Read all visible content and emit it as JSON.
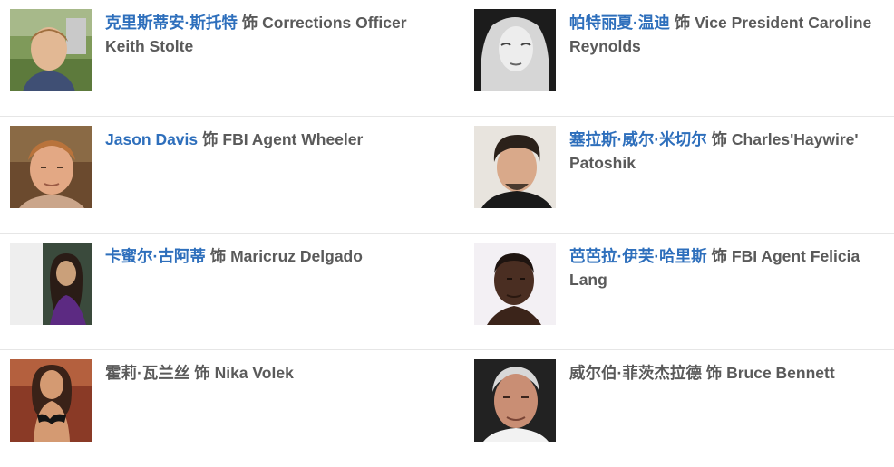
{
  "cast": [
    {
      "actor": "克里斯蒂安·斯托特",
      "actor_linked": true,
      "role_prefix": "饰",
      "role": "Corrections Officer Keith Stolte",
      "photo": "portrait-young-man-outdoors"
    },
    {
      "actor": "帕特丽夏·温迪",
      "actor_linked": true,
      "role_prefix": "饰",
      "role": "Vice President Caroline Reynolds",
      "photo": "portrait-blonde-woman-bw"
    },
    {
      "actor": "Jason Davis",
      "actor_linked": true,
      "role_prefix": "饰",
      "role": "FBI Agent Wheeler",
      "photo": "portrait-ginger-man"
    },
    {
      "actor": "塞拉斯·威尔·米切尔",
      "actor_linked": true,
      "role_prefix": "饰",
      "role": "Charles'Haywire' Patoshik",
      "photo": "portrait-dark-haired-man"
    },
    {
      "actor": "卡蜜尔·古阿蒂",
      "actor_linked": true,
      "role_prefix": "饰",
      "role": "Maricruz Delgado",
      "photo": "portrait-woman-purple-dress"
    },
    {
      "actor": "芭芭拉·伊芙·哈里斯",
      "actor_linked": true,
      "role_prefix": "饰",
      "role": "FBI Agent Felicia Lang",
      "photo": "portrait-woman-short-hair"
    },
    {
      "actor": "霍莉·瓦兰丝",
      "actor_linked": false,
      "role_prefix": "饰",
      "role": "Nika Volek",
      "photo": "portrait-woman-bikini"
    },
    {
      "actor": "威尔伯·菲茨杰拉德",
      "actor_linked": false,
      "role_prefix": "饰",
      "role": "Bruce Bennett",
      "photo": "portrait-older-man"
    }
  ]
}
